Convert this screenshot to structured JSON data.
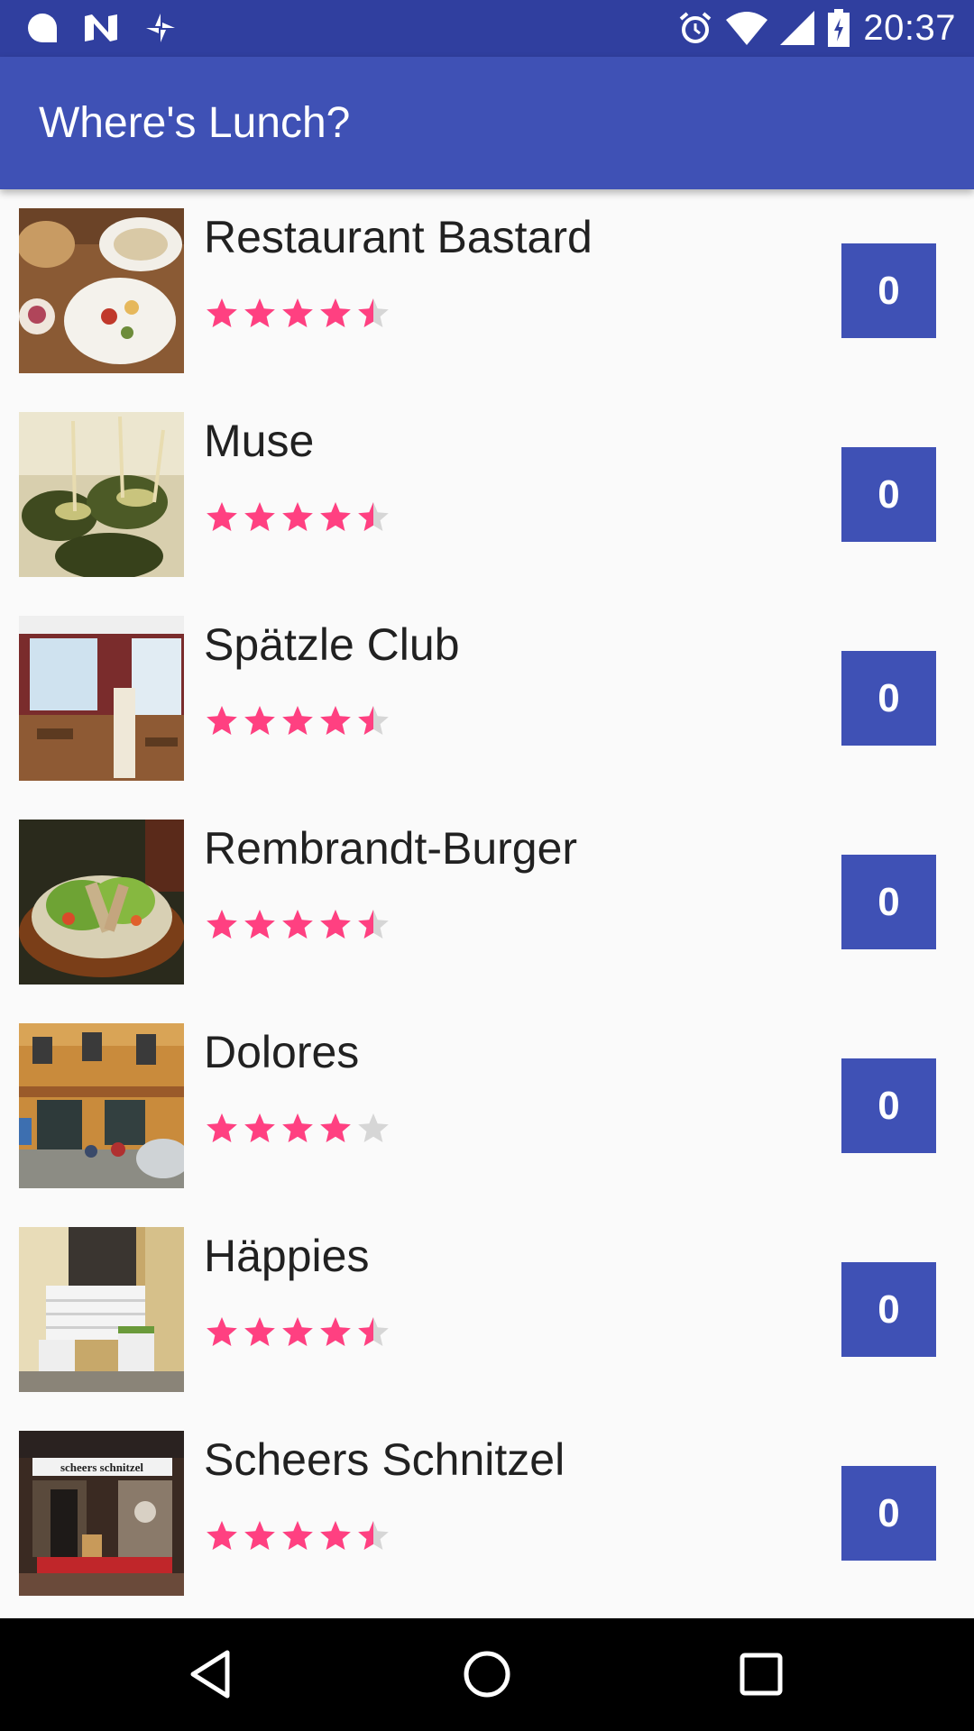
{
  "status_bar": {
    "time": "20:37",
    "left_icons": [
      "messenger-icon",
      "n-icon",
      "pinwheel-icon"
    ],
    "right_icons": [
      "alarm-icon",
      "wifi-icon",
      "signal-icon",
      "battery-icon"
    ]
  },
  "app_bar": {
    "title": "Where's Lunch?"
  },
  "colors": {
    "primary": "#3f51b5",
    "primary_dark": "#303f9f",
    "star_filled": "#ff4081",
    "star_empty": "#d6d6d6"
  },
  "restaurants": [
    {
      "name": "Restaurant Bastard",
      "rating": 4.5,
      "votes": "0",
      "image": "food-platter-image"
    },
    {
      "name": "Muse",
      "rating": 4.5,
      "votes": "0",
      "image": "zucchini-rolls-image"
    },
    {
      "name": "Spätzle Club",
      "rating": 4.5,
      "votes": "0",
      "image": "restaurant-interior-image"
    },
    {
      "name": "Rembrandt-Burger",
      "rating": 4.5,
      "votes": "0",
      "image": "salad-plate-image"
    },
    {
      "name": "Dolores",
      "rating": 4.0,
      "votes": "0",
      "image": "street-facade-image"
    },
    {
      "name": "Häppies",
      "rating": 4.5,
      "votes": "0",
      "image": "storefront-seating-image"
    },
    {
      "name": "Scheers Schnitzel",
      "rating": 4.5,
      "votes": "0",
      "image": "scheers-schnitzel-storefront-image"
    }
  ],
  "scheers_sign_text": "scheers schnitzel",
  "nav_bar": [
    "back-icon",
    "home-icon",
    "recents-icon"
  ]
}
